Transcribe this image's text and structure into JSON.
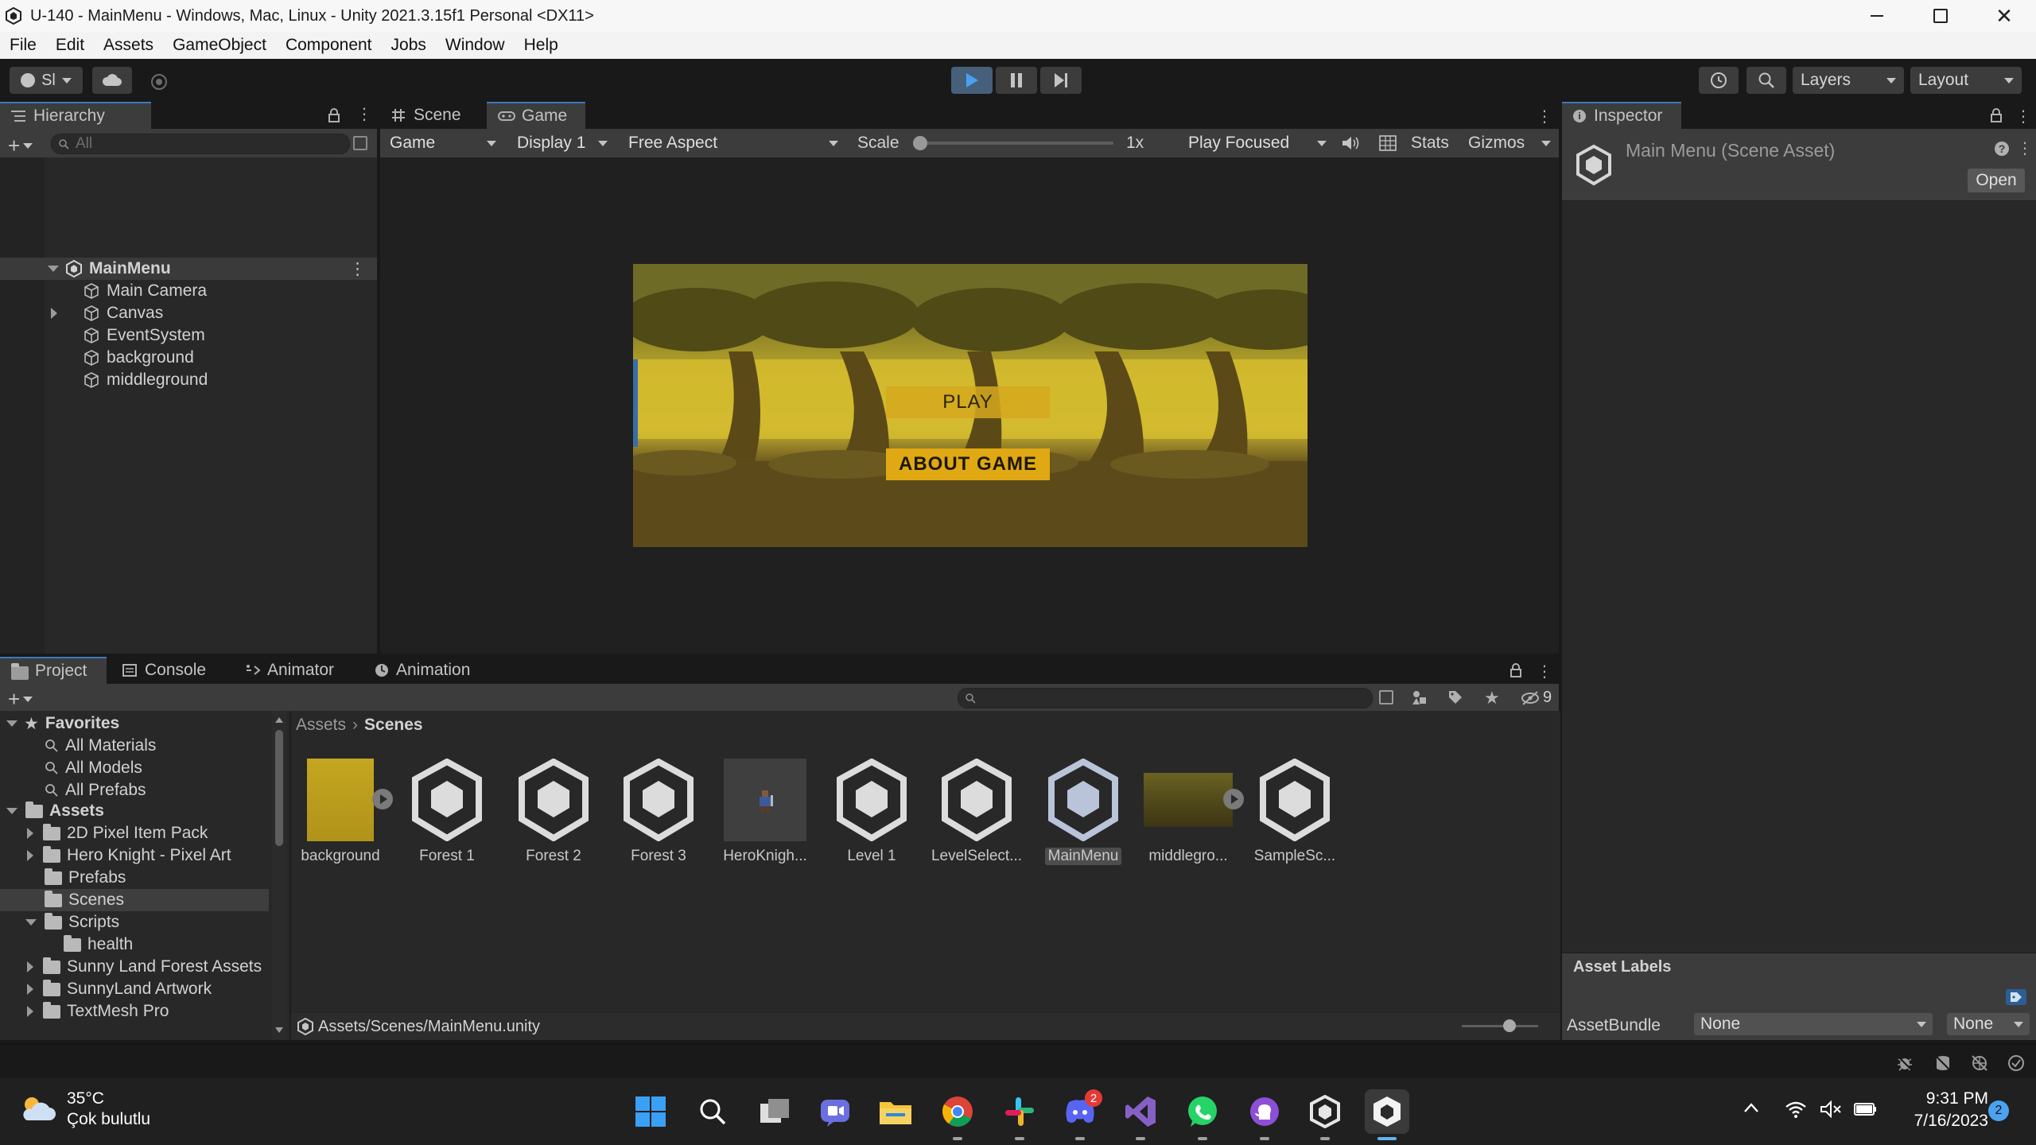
{
  "window": {
    "title": "U-140 - MainMenu - Windows, Mac, Linux - Unity 2021.3.15f1 Personal <DX11>"
  },
  "menu": [
    "File",
    "Edit",
    "Assets",
    "GameObject",
    "Component",
    "Jobs",
    "Window",
    "Help"
  ],
  "toolbar": {
    "account_label": "Sl",
    "layers_label": "Layers",
    "layout_label": "Layout"
  },
  "hierarchy": {
    "tab_label": "Hierarchy",
    "search_placeholder": "All",
    "scene_name": "MainMenu",
    "items": [
      {
        "label": "Main Camera",
        "expandable": false
      },
      {
        "label": "Canvas",
        "expandable": true
      },
      {
        "label": "EventSystem",
        "expandable": false
      },
      {
        "label": "background",
        "expandable": false
      },
      {
        "label": "middleground",
        "expandable": false
      }
    ]
  },
  "scene_view": {
    "tabs": [
      "Scene",
      "Game"
    ],
    "active_tab": "Game",
    "display_mode": "Game",
    "display": "Display 1",
    "aspect": "Free Aspect",
    "scale_label": "Scale",
    "scale_value": "1x",
    "play_mode": "Play Focused",
    "stats_label": "Stats",
    "gizmos_label": "Gizmos",
    "game_buttons": {
      "play": "PLAY",
      "about": "ABOUT GAME"
    }
  },
  "inspector": {
    "tab_label": "Inspector",
    "asset_title": "Main Menu (Scene Asset)",
    "open_button": "Open",
    "asset_labels": "Asset Labels",
    "assetbundle_label": "AssetBundle",
    "assetbundle_value": "None",
    "variant_value": "None"
  },
  "bottom_tabs": [
    "Project",
    "Console",
    "Animator",
    "Animation"
  ],
  "project": {
    "hidden_count": "9",
    "favorites_label": "Favorites",
    "favorites": [
      "All Materials",
      "All Models",
      "All Prefabs"
    ],
    "assets_label": "Assets",
    "folders": [
      {
        "label": "2D Pixel Item Pack",
        "indent": 1,
        "expandable": true
      },
      {
        "label": "Hero Knight - Pixel Art",
        "indent": 1,
        "expandable": true
      },
      {
        "label": "Prefabs",
        "indent": 1,
        "expandable": false
      },
      {
        "label": "Scenes",
        "indent": 1,
        "expandable": false
      },
      {
        "label": "Scripts",
        "indent": 1,
        "expandable": true
      },
      {
        "label": "health",
        "indent": 2,
        "expandable": false
      },
      {
        "label": "Sunny Land Forest Assets",
        "indent": 1,
        "expandable": true
      },
      {
        "label": "SunnyLand Artwork",
        "indent": 1,
        "expandable": true
      },
      {
        "label": "TextMesh Pro",
        "indent": 1,
        "expandable": true
      }
    ],
    "breadcrumb": [
      "Assets",
      "Scenes"
    ],
    "grid": [
      {
        "label": "background",
        "kind": "sprite"
      },
      {
        "label": "Forest 1",
        "kind": "scene"
      },
      {
        "label": "Forest 2",
        "kind": "scene"
      },
      {
        "label": "Forest 3",
        "kind": "scene"
      },
      {
        "label": "HeroKnigh...",
        "kind": "prefab"
      },
      {
        "label": "Level 1",
        "kind": "scene"
      },
      {
        "label": "LevelSelect...",
        "kind": "scene"
      },
      {
        "label": "MainMenu",
        "kind": "scene"
      },
      {
        "label": "middlegro...",
        "kind": "sprite"
      },
      {
        "label": "SampleSc...",
        "kind": "scene"
      }
    ],
    "selected_path": "Assets/Scenes/MainMenu.unity"
  },
  "taskbar": {
    "weather_temp": "35°C",
    "weather_desc": "Çok bulutlu",
    "time": "9:31 PM",
    "date": "7/16/2023",
    "discord_badge": "2",
    "notification_count": "2"
  }
}
